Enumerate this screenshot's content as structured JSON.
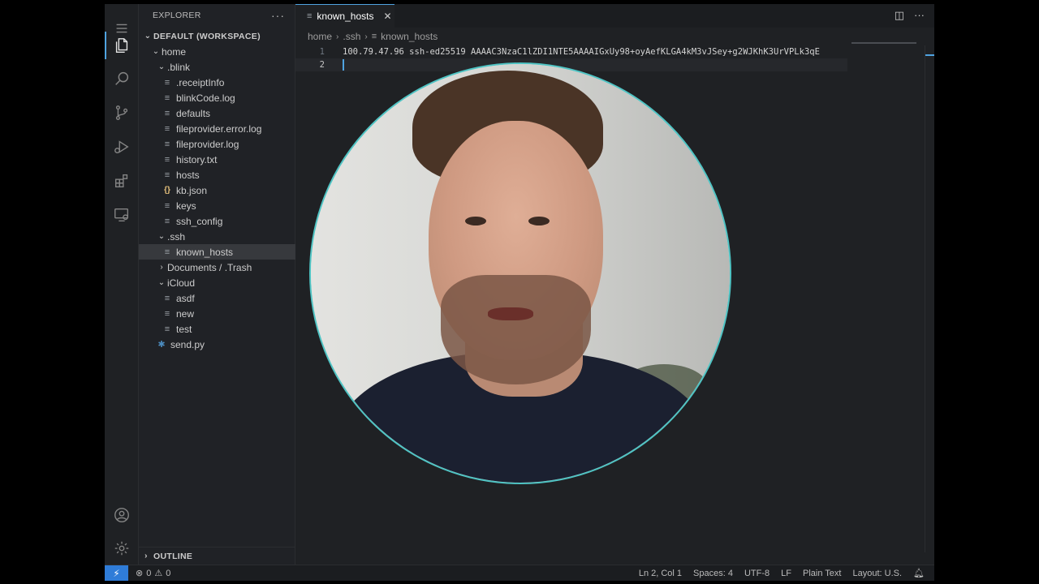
{
  "sidebar": {
    "title": "EXPLORER",
    "more": "···",
    "workspace": "DEFAULT (WORKSPACE)",
    "items": [
      {
        "label": "home"
      },
      {
        "label": ".blink"
      },
      {
        "label": ".receiptInfo"
      },
      {
        "label": "blinkCode.log"
      },
      {
        "label": "defaults"
      },
      {
        "label": "fileprovider.error.log"
      },
      {
        "label": "fileprovider.log"
      },
      {
        "label": "history.txt"
      },
      {
        "label": "hosts"
      },
      {
        "label": "kb.json"
      },
      {
        "label": "keys"
      },
      {
        "label": "ssh_config"
      },
      {
        "label": ".ssh"
      },
      {
        "label": "known_hosts"
      },
      {
        "label": "Documents / .Trash"
      },
      {
        "label": "iCloud"
      },
      {
        "label": "asdf"
      },
      {
        "label": "new"
      },
      {
        "label": "test"
      },
      {
        "label": "send.py"
      }
    ],
    "outline": "OUTLINE"
  },
  "editor": {
    "tab": "known_hosts",
    "breadcrumb": [
      "home",
      ".ssh",
      "known_hosts"
    ],
    "lines": [
      {
        "num": "1",
        "text": "100.79.47.96 ssh-ed25519 AAAAC3NzaC1lZDI1NTE5AAAAIGxUy98+oyAefKLGA4kM3vJSey+g2WJKhK3UrVPLk3qE"
      },
      {
        "num": "2",
        "text": ""
      }
    ]
  },
  "status": {
    "errors": "0",
    "warnings": "0",
    "position": "Ln 2, Col 1",
    "spaces": "Spaces: 4",
    "encoding": "UTF-8",
    "eol": "LF",
    "language": "Plain Text",
    "layout": "Layout: U.S."
  },
  "colors": {
    "accent": "#4fa3e0",
    "remote": "#2f7cd8",
    "webcam_border": "#4fc4c4"
  }
}
